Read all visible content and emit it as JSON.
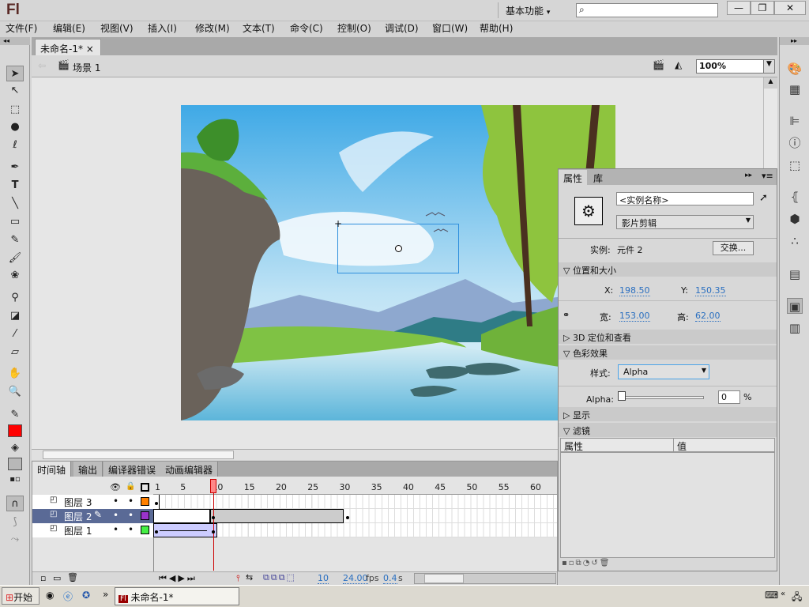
{
  "app": {
    "logo": "Fl",
    "workspace": "基本功能",
    "workspace_arrow": "▾",
    "search_placeholder": "",
    "window_controls": [
      "—",
      "❐",
      "✕"
    ]
  },
  "menu": [
    "文件(F)",
    "编辑(E)",
    "视图(V)",
    "插入(I)",
    "修改(M)",
    "文本(T)",
    "命令(C)",
    "控制(O)",
    "调试(D)",
    "窗口(W)",
    "帮助(H)"
  ],
  "document": {
    "tab": "未命名-1*",
    "tab_close": "×",
    "scene": "场景 1",
    "zoom": "100%"
  },
  "timeline": {
    "tabs": [
      "时间轴",
      "输出",
      "编译器错误",
      "动画编辑器"
    ],
    "frame_numbers": [
      "1",
      "5",
      "10",
      "15",
      "20",
      "25",
      "30",
      "35",
      "40",
      "45",
      "50",
      "55",
      "60"
    ],
    "layers": [
      {
        "name": "图层 3",
        "color": "#ff8000"
      },
      {
        "name": "图层 2",
        "color": "#9933cc"
      },
      {
        "name": "图层 1",
        "color": "#44ee44"
      }
    ],
    "current_frame": "10",
    "fps": "24.00",
    "fps_unit": "fps",
    "time": "0.4",
    "time_unit": "s"
  },
  "properties": {
    "tabs": [
      "属性",
      "库"
    ],
    "instance_name_placeholder": "<实例名称>",
    "type": "影片剪辑",
    "instance_label": "实例:",
    "instance_value": "元件 2",
    "swap": "交换...",
    "sections": {
      "position": "位置和大小",
      "3d": "3D 定位和查看",
      "color": "色彩效果",
      "display": "显示",
      "filters": "滤镜"
    },
    "x_label": "X:",
    "x": "198.50",
    "y_label": "Y:",
    "y": "150.35",
    "w_label": "宽:",
    "w": "153.00",
    "h_label": "高:",
    "h": "62.00",
    "style_label": "样式:",
    "style": "Alpha",
    "alpha_label": "Alpha:",
    "alpha": "0",
    "alpha_unit": "%",
    "filter_cols": [
      "属性",
      "值"
    ]
  },
  "taskbar": {
    "start": "开始",
    "task": "未命名-1*",
    "chevron": "»"
  }
}
